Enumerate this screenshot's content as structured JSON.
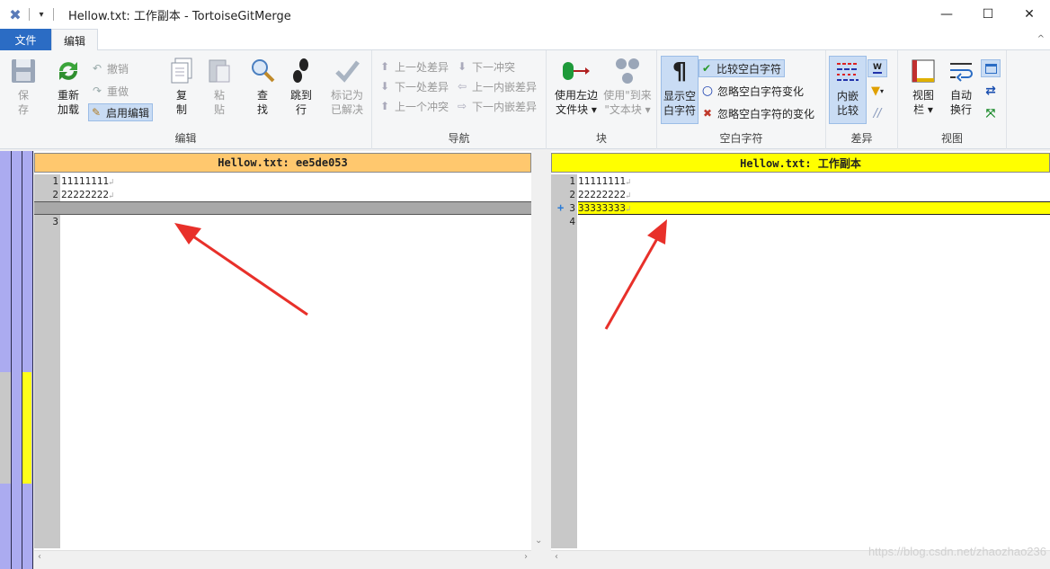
{
  "window": {
    "title": "Hellow.txt: 工作副本 - TortoiseGitMerge",
    "minimize": "—",
    "maximize": "☐",
    "close": "✕"
  },
  "quick_access": {
    "menu": "▾"
  },
  "tabs": {
    "file": "文件",
    "edit": "编辑",
    "collapse": "^"
  },
  "ribbon": {
    "groups": {
      "edit": "编辑",
      "navigate": "导航",
      "block": "块",
      "whitespace": "空白字符",
      "diff": "差异",
      "view": "视图"
    },
    "save": [
      "保",
      "存"
    ],
    "reload": [
      "重新",
      "加载"
    ],
    "undo": "撤销",
    "redo": "重做",
    "enable_edit": "启用编辑",
    "copy": [
      "复",
      "制"
    ],
    "paste": [
      "粘",
      "贴"
    ],
    "find": [
      "查",
      "找"
    ],
    "goto": [
      "跳到",
      "行"
    ],
    "mark_resolved": [
      "标记为",
      "已解决"
    ],
    "nav": {
      "prev_diff": "上一处差异",
      "next_conflict": "下一冲突",
      "next_diff": "下一处差异",
      "prev_inline": "上一内嵌差异",
      "prev_conflict": "上一个冲突",
      "next_inline": "下一内嵌差异"
    },
    "use_left": [
      "使用左边",
      "文件块 ▾"
    ],
    "use_from": [
      "使用\"到来",
      "\"文本块 ▾"
    ],
    "show_ws": [
      "显示空",
      "白字符"
    ],
    "compare_ws": "比较空白字符",
    "ignore_ws_change": "忽略空白字符变化",
    "ignore_all_ws": "忽略空白字符的变化",
    "inline_diff": [
      "内嵌",
      "比较"
    ],
    "view_bar": [
      "视图",
      "栏 ▾"
    ],
    "auto_wrap": [
      "自动",
      "换行"
    ]
  },
  "left_pane": {
    "header": "Hellow.txt: ee5de053",
    "header_color": "#ffc86e",
    "lines": [
      {
        "num": "1",
        "text": "11111111"
      },
      {
        "num": "2",
        "text": "22222222"
      },
      {
        "num": "",
        "text": ""
      },
      {
        "num": "3",
        "text": ""
      }
    ]
  },
  "right_pane": {
    "header": "Hellow.txt: 工作副本",
    "header_color": "#ffff00",
    "lines": [
      {
        "num": "1",
        "text": "11111111"
      },
      {
        "num": "2",
        "text": "22222222"
      },
      {
        "num": "3",
        "text": "33333333",
        "marker": "+"
      },
      {
        "num": "4",
        "text": ""
      }
    ]
  },
  "eol_glyph": "↲",
  "watermark": "https://blog.csdn.net/zhaozhao236"
}
